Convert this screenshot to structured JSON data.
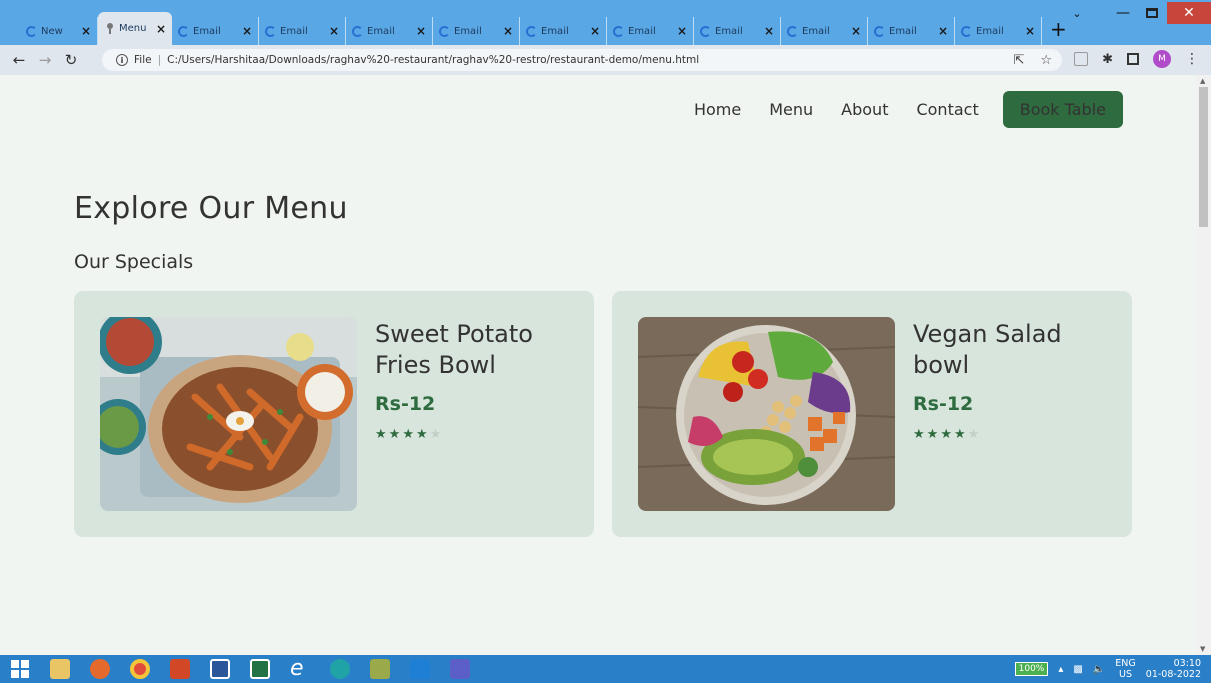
{
  "browser": {
    "tabs": [
      {
        "label": "New",
        "active": false
      },
      {
        "label": "Menu",
        "active": true
      },
      {
        "label": "Email",
        "active": false
      },
      {
        "label": "Email",
        "active": false
      },
      {
        "label": "Email",
        "active": false
      },
      {
        "label": "Email",
        "active": false
      },
      {
        "label": "Email",
        "active": false
      },
      {
        "label": "Email",
        "active": false
      },
      {
        "label": "Email",
        "active": false
      },
      {
        "label": "Email",
        "active": false
      },
      {
        "label": "Email",
        "active": false
      },
      {
        "label": "Email",
        "active": false
      }
    ],
    "tab_close_glyph": "×",
    "new_tab_glyph": "+",
    "address": {
      "scheme_label": "File",
      "url": "C:/Users/Harshitaa/Downloads/raghav%20-restaurant/raghav%20-restro/restaurant-demo/menu.html"
    },
    "profile_initial": "M"
  },
  "site": {
    "nav": {
      "items": [
        "Home",
        "Menu",
        "About",
        "Contact"
      ],
      "cta": "Book Table"
    },
    "title": "Explore Our Menu",
    "subtitle": "Our Specials",
    "cards": [
      {
        "name": "Sweet Potato Fries Bowl",
        "price": "Rs-12",
        "rating": 4,
        "max_rating": 5
      },
      {
        "name": "Vegan Salad bowl",
        "price": "Rs-12",
        "rating": 4,
        "max_rating": 5
      }
    ],
    "colors": {
      "accent": "#2e6b3e",
      "card_bg": "#d8e5dc",
      "page_bg": "#f1f5f1"
    }
  },
  "taskbar": {
    "battery": "100%",
    "lang_top": "ENG",
    "lang_bottom": "US",
    "time": "03:10",
    "date": "01-08-2022"
  }
}
